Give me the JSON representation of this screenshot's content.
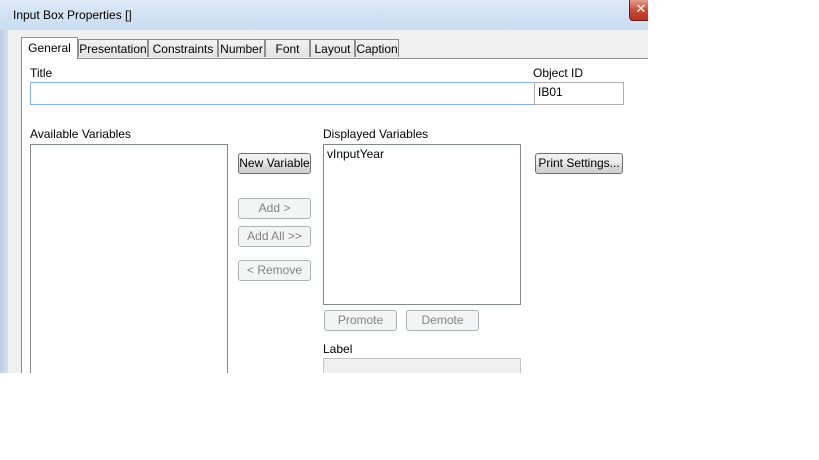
{
  "window": {
    "title": "Input Box Properties []",
    "close_glyph": "✕"
  },
  "tabs": [
    {
      "label": "General",
      "active": true
    },
    {
      "label": "Presentation",
      "active": false
    },
    {
      "label": "Constraints",
      "active": false
    },
    {
      "label": "Number",
      "active": false
    },
    {
      "label": "Font",
      "active": false
    },
    {
      "label": "Layout",
      "active": false
    },
    {
      "label": "Caption",
      "active": false
    }
  ],
  "general": {
    "title_label": "Title",
    "title_value": "",
    "object_id_label": "Object ID",
    "object_id_value": "IB01",
    "available_label": "Available Variables",
    "available_items": [],
    "displayed_label": "Displayed Variables",
    "displayed_items": [
      "vInputYear"
    ],
    "new_variable_button": "New Variable",
    "add_button": "Add >",
    "add_all_button": "Add All >>",
    "remove_button": "< Remove",
    "promote_button": "Promote",
    "demote_button": "Demote",
    "print_settings_button": "Print Settings...",
    "label_label": "Label",
    "label_value": ""
  }
}
